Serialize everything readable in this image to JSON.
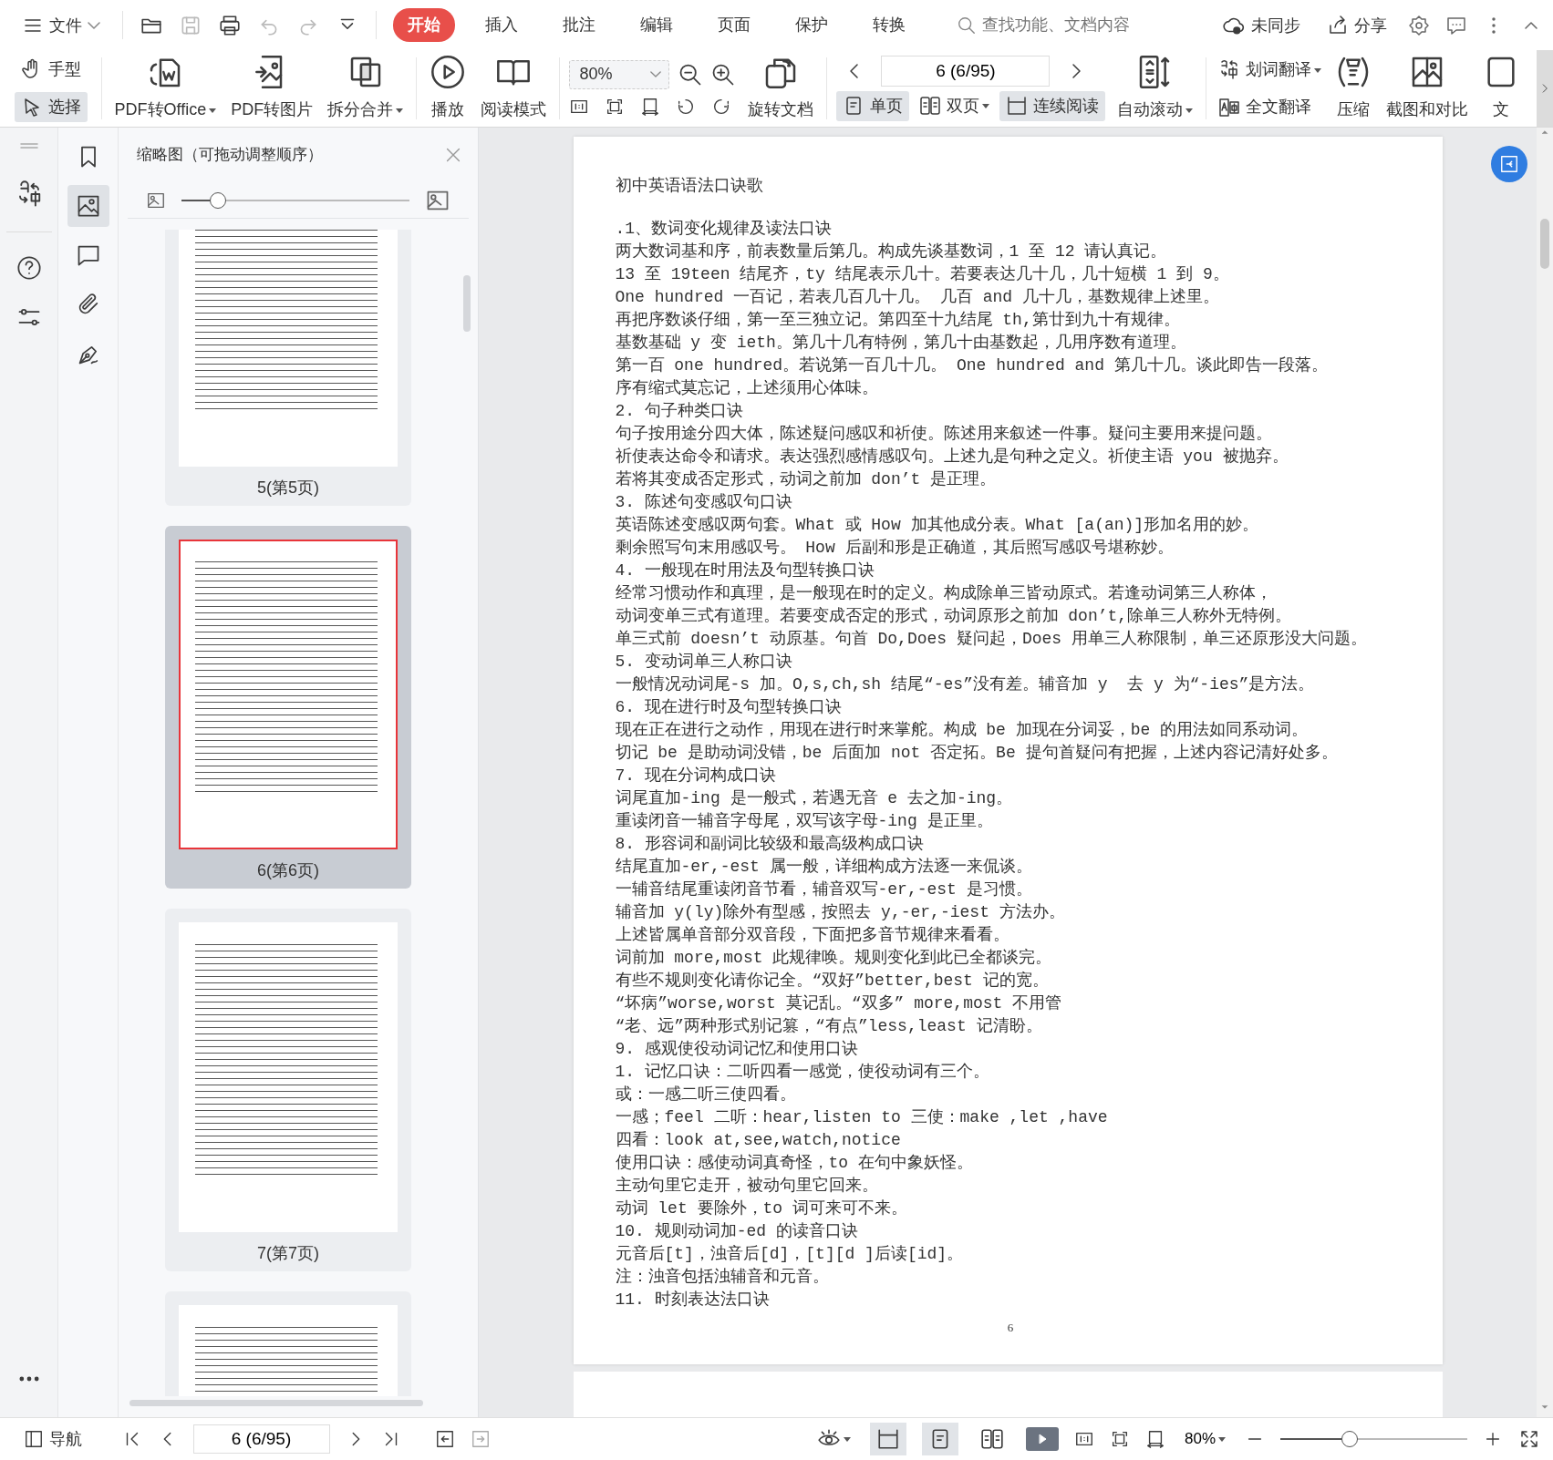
{
  "menu_bar": {
    "file_menu": "文件",
    "tabs": [
      {
        "label": "开始",
        "selected": true
      },
      {
        "label": "插入",
        "selected": false
      },
      {
        "label": "批注",
        "selected": false
      },
      {
        "label": "编辑",
        "selected": false
      },
      {
        "label": "页面",
        "selected": false
      },
      {
        "label": "保护",
        "selected": false
      },
      {
        "label": "转换",
        "selected": false
      }
    ],
    "search": {
      "placeholder": "查找功能、文档内容"
    },
    "sync_status": "未同步",
    "share": "分享"
  },
  "ribbon": {
    "pointer_tools": [
      {
        "label": "手型",
        "selected": false
      },
      {
        "label": "选择",
        "selected": true
      }
    ],
    "convert_buttons": [
      {
        "label": "PDF转Office",
        "dropdown": true
      },
      {
        "label": "PDF转图片",
        "dropdown": false
      },
      {
        "label": "拆分合并",
        "dropdown": true
      },
      {
        "label": "播放",
        "dropdown": false
      },
      {
        "label": "阅读模式",
        "dropdown": false
      }
    ],
    "zoom_box": {
      "value": "80%"
    },
    "rotate_button": "旋转文档",
    "page_box": {
      "value": "6 (6/95)"
    },
    "view_modes": [
      {
        "label": "单页",
        "selected": true,
        "dropdown": false
      },
      {
        "label": "双页",
        "selected": false,
        "dropdown": true
      },
      {
        "label": "连续阅读",
        "selected": true,
        "dropdown": false
      }
    ],
    "auto_scroll": {
      "label": "自动滚动",
      "dropdown": true
    },
    "translate_buttons": [
      {
        "label": "划词翻译",
        "dropdown": true
      },
      {
        "label": "全文翻译",
        "dropdown": false
      }
    ],
    "tool_buttons": [
      {
        "label": "压缩"
      },
      {
        "label": "截图和对比"
      },
      {
        "label": "文"
      }
    ]
  },
  "side_tabs": [
    {
      "selected": false
    },
    {
      "selected": true
    },
    {
      "selected": false
    },
    {
      "selected": false
    },
    {
      "selected": false
    }
  ],
  "thumbnail_panel": {
    "title": "缩略图（可拖动调整顺序）",
    "size_slider": {
      "level": 0.16
    },
    "thumbnails": [
      {
        "label": "5(第5页)",
        "selected": false
      },
      {
        "label": "6(第6页)",
        "selected": true
      },
      {
        "label": "7(第7页)",
        "selected": false
      }
    ]
  },
  "document": {
    "title": "初中英语语法口诀歌",
    "lines": [
      ".1、数词变化规律及读法口诀",
      "两大数词基和序，前表数量后第几。构成先谈基数词，1 至 12 请认真记。",
      "13 至 19teen 结尾齐，ty 结尾表示几十。若要表达几十几，几十短横 1 到 9。",
      "One hundred 一百记，若表几百几十几。 几百 and 几十几，基数规律上述里。",
      "再把序数谈仔细，第一至三独立记。第四至十九结尾 th,第廿到九十有规律。",
      "基数基础 y 变 ieth。第几十几有特例，第几十由基数起，几用序数有道理。",
      "第一百 one hundred。若说第一百几十几。 One hundred and 第几十几。谈此即告一段落。",
      "序有缩式莫忘记，上述须用心体味。",
      "2. 句子种类口诀",
      "句子按用途分四大体，陈述疑问感叹和祈使。陈述用来叙述一件事。疑问主要用来提问题。",
      "祈使表达命令和请求。表达强烈感情感叹句。上述九是句种之定义。祈使主语 you 被抛弃。",
      "若将其变成否定形式，动词之前加 don’t 是正理。",
      "3. 陈述句变感叹句口诀",
      "英语陈述变感叹两句套。What 或 How 加其他成分表。What [a(an)]形加名用的妙。",
      "剩余照写句末用感叹号。 How 后副和形是正确道，其后照写感叹号堪称妙。",
      "4. 一般现在时用法及句型转换口诀",
      "经常习惯动作和真理，是一般现在时的定义。构成除单三皆动原式。若逢动词第三人称体，",
      "动词变单三式有道理。若要变成否定的形式，动词原形之前加 don’t,除单三人称外无特例。",
      "单三式前 doesn’t 动原基。句首 Do,Does 疑问起，Does 用单三人称限制，单三还原形没大问题。",
      "5. 变动词单三人称口诀",
      "一般情况动词尾-s 加。O,s,ch,sh 结尾“-es”没有差。辅音加 y  去 y 为“-ies”是方法。",
      "6. 现在进行时及句型转换口诀",
      "现在正在进行之动作，用现在进行时来掌舵。构成 be 加现在分词妥，be 的用法如同系动词。",
      "切记 be 是助动词没错，be 后面加 not 否定拓。Be 提句首疑问有把握，上述内容记清好处多。",
      "7. 现在分词构成口诀",
      "词尾直加-ing 是一般式，若遇无音 e 去之加-ing。",
      "重读闭音一辅音字母尾，双写该字母-ing 是正里。",
      "8. 形容词和副词比较级和最高级构成口诀",
      "结尾直加-er,-est 属一般，详细构成方法逐一来侃谈。",
      "一辅音结尾重读闭音节看，辅音双写-er,-est 是习惯。",
      "辅音加 y(ly)除外有型感，按照去 y,-er,-iest 方法办。",
      "上述皆属单音部分双音段，下面把多音节规律来看看。",
      "词前加 more,most 此规律唤。规则变化到此已全都谈完。",
      "有些不规则变化请你记全。“双好”better,best 记的宽。",
      "“坏病”worse,worst 莫记乱。“双多” more,most 不用管",
      "“老、远”两种形式别记篡，“有点”less,least 记清盼。",
      "9. 感观使役动词记忆和使用口诀",
      "1. 记忆口诀：二听四看一感觉，使役动词有三个。",
      "或：一感二听三使四看。",
      "一感；feel 二听：hear,listen to 三使：make ,let ,have",
      "四看：look at,see,watch,notice",
      "使用口诀：感使动词真奇怪，to 在句中象妖怪。",
      "主动句里它走开，被动句里它回来。",
      "动词 let 要除外，to 词可来可不来。",
      "10. 规则动词加-ed 的读音口诀",
      "元音后[t]，浊音后[d]，[t][d ]后读[id]。",
      "注：浊音包括浊辅音和元音。",
      "11. 时刻表达法口诀"
    ],
    "page_number": "6"
  },
  "status_bar": {
    "nav_label": "导航",
    "page_box": {
      "value": "6 (6/95)"
    },
    "view_buttons": [
      {
        "selected": true
      },
      {
        "selected": true
      },
      {
        "selected": false
      }
    ],
    "zoom": "80%",
    "zoom_slider": {
      "level": 0.37
    }
  }
}
